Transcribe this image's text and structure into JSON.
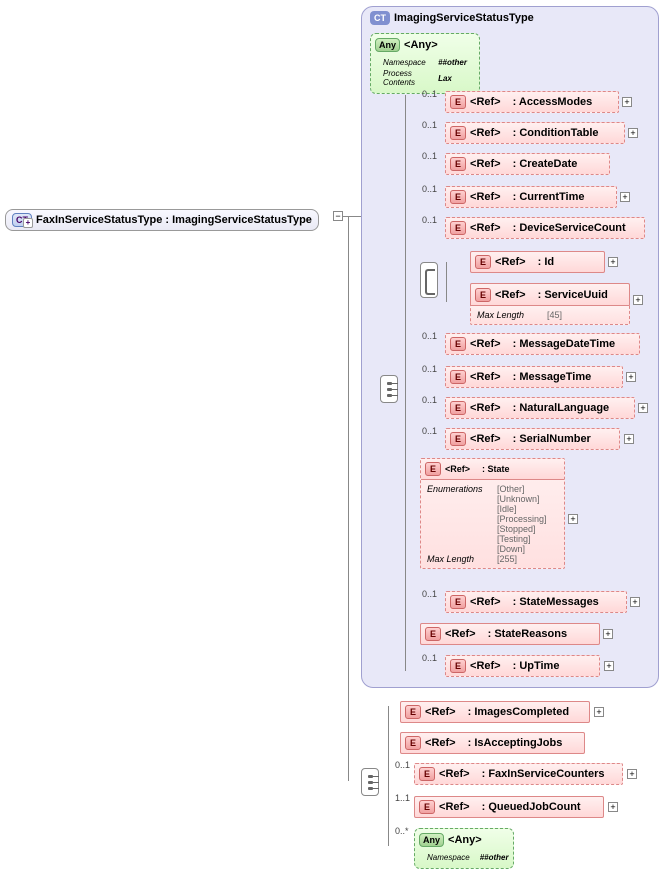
{
  "root": {
    "ct_label": "CT",
    "name": "FaxInServiceStatusType : ImagingServiceStatusType"
  },
  "container": {
    "ct_label": "CT",
    "title": "ImagingServiceStatusType"
  },
  "any_top": {
    "badge": "Any",
    "label": "<Any>",
    "ns_label": "Namespace",
    "ns_value": "##other",
    "pc_label": "Process Contents",
    "pc_value": "Lax"
  },
  "ref_label": "<Ref>",
  "e_label": "E",
  "nodes": {
    "access_modes": ": AccessModes",
    "condition_table": ": ConditionTable",
    "create_date": ": CreateDate",
    "current_time": ": CurrentTime",
    "device_service_count": ": DeviceServiceCount",
    "id": ": Id",
    "service_uuid": ": ServiceUuid",
    "message_date_time": ": MessageDateTime",
    "message_time": ": MessageTime",
    "natural_language": ": NaturalLanguage",
    "serial_number": ": SerialNumber",
    "state": ": State",
    "state_messages": ": StateMessages",
    "state_reasons": ": StateReasons",
    "up_time": ": UpTime",
    "images_completed": ": ImagesCompleted",
    "is_accepting_jobs": ": IsAcceptingJobs",
    "faxin_service_counters": ": FaxInServiceCounters",
    "queued_job_count": ": QueuedJobCount"
  },
  "service_uuid_meta": {
    "max_length_label": "Max Length",
    "max_length_value": "[45]"
  },
  "state_meta": {
    "enum_label": "Enumerations",
    "enums": [
      "[Other]",
      "[Unknown]",
      "[Idle]",
      "[Processing]",
      "[Stopped]",
      "[Testing]",
      "[Down]"
    ],
    "max_length_label": "Max Length",
    "max_length_value": "[255]"
  },
  "occurs": {
    "opt": "0..1",
    "one_many": "1..1",
    "zero_many": "0..*"
  },
  "any_bottom": {
    "badge": "Any",
    "label": "<Any>",
    "ns_label": "Namespace",
    "ns_value": "##other"
  }
}
